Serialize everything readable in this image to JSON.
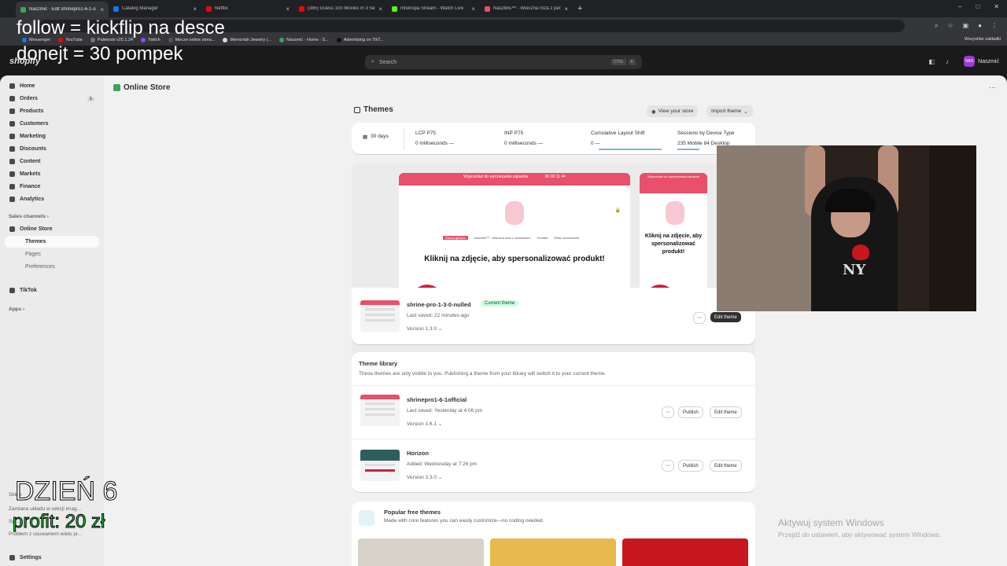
{
  "browser": {
    "tabs": [
      {
        "label": "Naszmić · Edit shrinepro1-6-1-o",
        "color": "#3fa35a"
      },
      {
        "label": "Catalog Manager",
        "color": "#1877f2"
      },
      {
        "label": "Netflix",
        "color": "#e50914"
      },
      {
        "label": "(385) Guess 100 Movies in 3 Se",
        "color": "#ff0000"
      },
      {
        "label": "mlskrupa Stream - Watch Live",
        "color": "#53fc18"
      },
      {
        "label": "NaszMis™ - Wieczna róża z pers",
        "color": "#e8506b"
      }
    ],
    "bookmarks": [
      {
        "label": "Messenger",
        "color": "#1877f2"
      },
      {
        "label": "YouTube",
        "color": "#ff0000"
      },
      {
        "label": "Paletools v25.1.24",
        "color": "#777777"
      },
      {
        "label": "Twitch",
        "color": "#9146ff"
      },
      {
        "label": "Mecze online strea...",
        "color": "#555555"
      },
      {
        "label": "Memoriah Jewelry (...",
        "color": "#d9d9d9"
      },
      {
        "label": "Naszmić · Home · S...",
        "color": "#3fa35a"
      },
      {
        "label": "Advertising on TikT...",
        "color": "#111111"
      }
    ],
    "bookmarks_right": "Wszystkie zakładki"
  },
  "shopify": {
    "logo": "shopify",
    "search_placeholder": "Search",
    "search_kbd": [
      "CTRL",
      "K"
    ],
    "store_initials": "NAS",
    "store_name": "Naszmić"
  },
  "sidebar": {
    "items": [
      {
        "label": "Home",
        "badge": ""
      },
      {
        "label": "Orders",
        "badge": "1"
      },
      {
        "label": "Products",
        "badge": ""
      },
      {
        "label": "Customers",
        "badge": ""
      },
      {
        "label": "Marketing",
        "badge": ""
      },
      {
        "label": "Discounts",
        "badge": ""
      },
      {
        "label": "Content",
        "badge": ""
      },
      {
        "label": "Markets",
        "badge": ""
      },
      {
        "label": "Finance",
        "badge": ""
      },
      {
        "label": "Analytics",
        "badge": ""
      }
    ],
    "sales_channels": "Sales channels",
    "online_store": "Online Store",
    "sub_items": [
      "Themes",
      "Pages",
      "Preferences"
    ],
    "tiktok": "TikTok",
    "apps": "Apps",
    "ghost_section": "Sklep",
    "ghost_lines": [
      "Zamiana układu w sekcji imag...",
      "Spr...",
      "Problem z usuwaniem wielu pr..."
    ],
    "settings": "Settings"
  },
  "page": {
    "title": "Online Store",
    "themes_heading": "Themes",
    "view_store": "View your store",
    "import_theme": "Import theme"
  },
  "metrics": {
    "period": "30 days",
    "items": [
      {
        "title": "LCP P75",
        "value": "0 milliseconds —"
      },
      {
        "title": "INP P75",
        "value": "0 milliseconds —"
      },
      {
        "title": "Cumulative Layout Shift",
        "value": "0 —"
      },
      {
        "title": "Sessions by Device Type",
        "value": "235 Mobile  84 Desktop"
      }
    ]
  },
  "preview": {
    "banner": "Wyprzedaż do wyczerpania zapasów",
    "timer": [
      "00",
      "00",
      "11",
      "44"
    ],
    "headline": "Kliknij na zdjęcie, aby spersonalizować produkt!",
    "menu": [
      "Strona główna",
      "NaszMis™ - Wieczna róża z nazwiskiem",
      "Kontakt",
      "Śledź zamówienie"
    ]
  },
  "current_theme": {
    "name": "shrine-pro-1-3-0-nulled",
    "badge": "Current theme",
    "saved": "Last saved: 22 minutes ago",
    "version": "Version 1.3.0",
    "edit": "Edit theme"
  },
  "library": {
    "title": "Theme library",
    "description": "These themes are only visible to you. Publishing a theme from your library will switch it to your current theme.",
    "themes": [
      {
        "name": "shrinepro1-6-1official",
        "saved": "Last saved: Yesterday at 4:06 pm",
        "version": "Version 1.6.1"
      },
      {
        "name": "Horizon",
        "saved": "Added: Wednesday at 7:26 pm",
        "version": "Version 3.3.0"
      }
    ],
    "publish": "Publish",
    "edit": "Edit theme"
  },
  "popular": {
    "title": "Popular free themes",
    "description": "Made with core features you can easily customize—no coding needed."
  },
  "overlay": {
    "line1": "follow = kickflip na desce",
    "line2": "donejt = 30 pompek",
    "day": "DZIEŃ 6",
    "profit": "profit: 20 zł"
  },
  "windows": {
    "activate": "Aktywuj system Windows",
    "activate_sub": "Przejdź do ustawień, aby aktywować system Windows."
  }
}
